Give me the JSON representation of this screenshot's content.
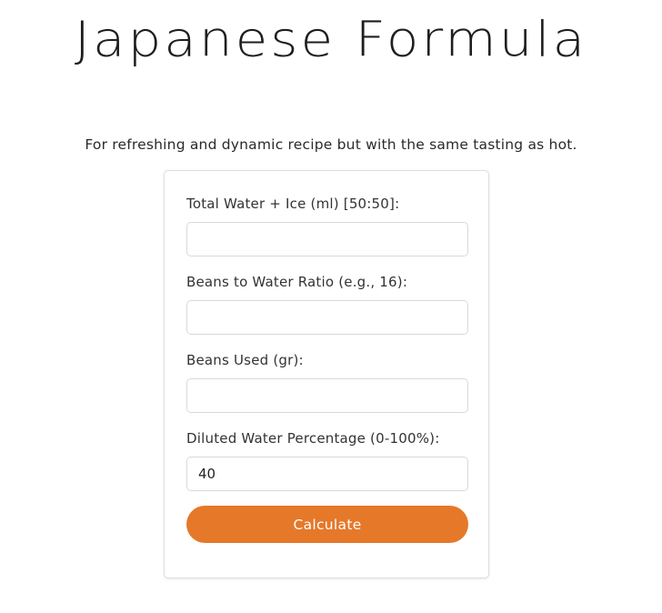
{
  "header": {
    "title": "Japanese Formula",
    "subtitle": "For refreshing and dynamic recipe but with the same tasting as hot."
  },
  "form": {
    "fields": [
      {
        "label": "Total Water + Ice (ml) [50:50]:",
        "value": "",
        "placeholder": ""
      },
      {
        "label": "Beans to Water Ratio (e.g., 16):",
        "value": "",
        "placeholder": ""
      },
      {
        "label": "Beans Used (gr):",
        "value": "",
        "placeholder": ""
      },
      {
        "label": "Diluted Water Percentage (0-100%):",
        "value": "40",
        "placeholder": ""
      }
    ],
    "submit_label": "Calculate"
  },
  "colors": {
    "accent": "#e6782a",
    "text": "#222222",
    "card_border": "#dddddd"
  }
}
